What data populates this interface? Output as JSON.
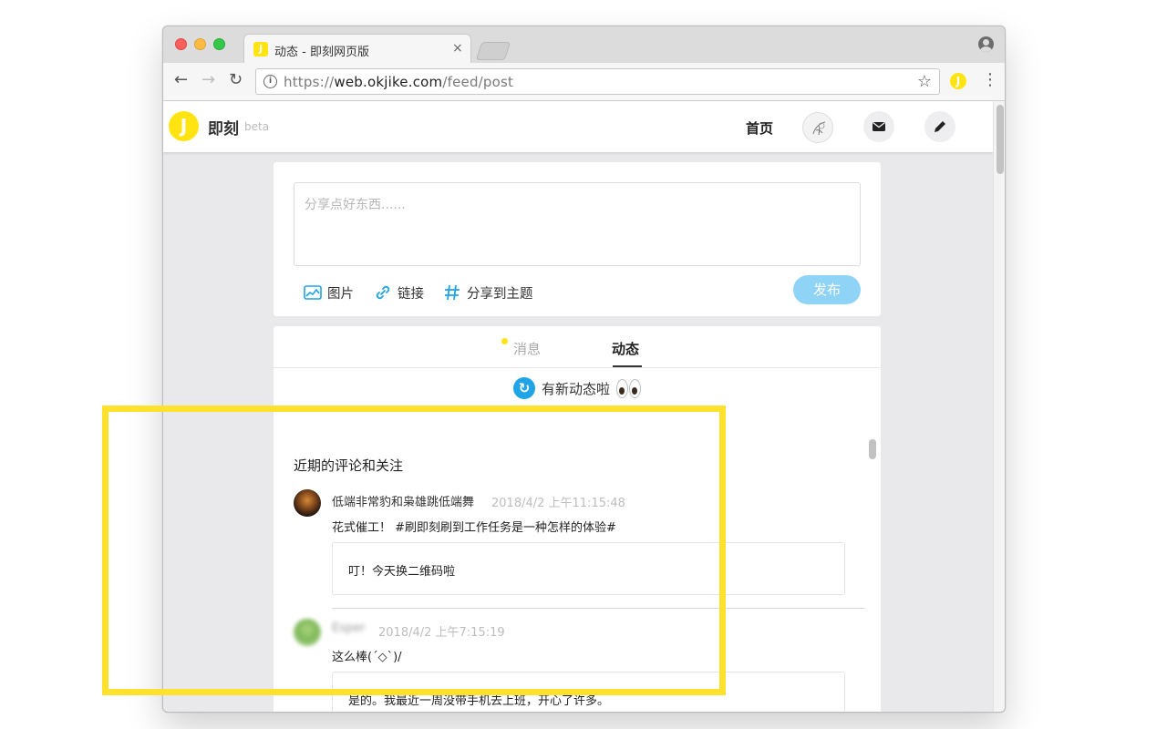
{
  "browser": {
    "tab_title": "动态 - 即刻网页版",
    "tab_favicon": "J",
    "tab_close": "×",
    "url_scheme": "https://",
    "url_host": "web.okjike.com",
    "url_path": "/feed/post",
    "back": "←",
    "forward": "→",
    "reload": "↻",
    "star": "☆",
    "menu": "⋮",
    "info": "i",
    "extension": "J",
    "icons": {
      "back": "arrow-left-icon",
      "forward": "arrow-right-icon",
      "reload": "reload-icon",
      "info": "info-icon",
      "star": "star-icon",
      "profile": "profile-icon",
      "menu": "vertical-dots-icon"
    }
  },
  "site": {
    "logo": "J",
    "name": "即刻",
    "beta": "beta",
    "nav_home": "首页",
    "brand_color": "#ffe411",
    "accent_color": "#1fa4e6"
  },
  "composer": {
    "placeholder": "分享点好东西......",
    "tools": {
      "image": "图片",
      "link": "链接",
      "topic": "分享到主题"
    },
    "publish": "发布"
  },
  "feed": {
    "tabs": [
      {
        "label": "消息",
        "active": false,
        "has_dot": true
      },
      {
        "label": "动态",
        "active": true
      }
    ],
    "new_notice": "有新动态啦"
  },
  "recent": {
    "title": "近期的评论和关注",
    "items": [
      {
        "name": "低端非常豹和枭雄跳低端舞",
        "time": "2018/4/2 上午11:15:48",
        "text": "花式催工！ #刷即刻刷到工作任务是一种怎样的体验#",
        "quote": "叮！今天换二维码啦"
      },
      {
        "name": "Esper",
        "time": "2018/4/2 上午7:15:19",
        "text": "这么棒(ˊ◇ˋ)/",
        "quote": "是的。我最近一周没带手机去上班，开心了许多。"
      }
    ]
  },
  "highlight_color": "#ffe12e"
}
